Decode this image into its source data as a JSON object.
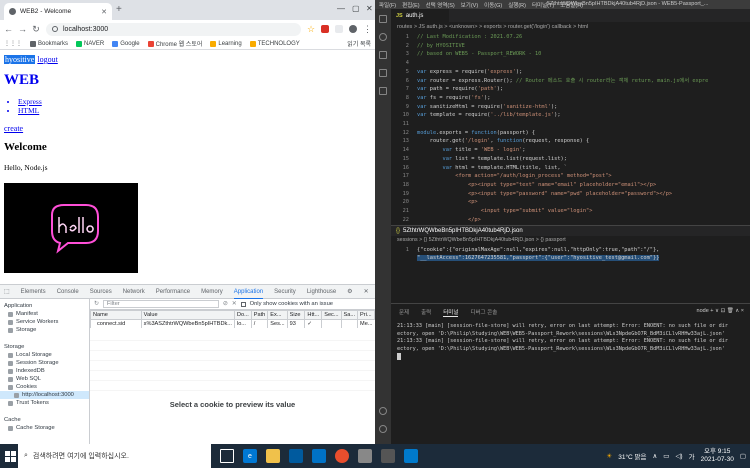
{
  "browser": {
    "tab_title": "WEB2 - Welcome",
    "url": "localhost:3000",
    "bookmarks": [
      "Bookmarks",
      "NAVER",
      "Google",
      "Chrome 웹 스토어",
      "Learning",
      "TECHNOLOGY",
      "읽기 목록"
    ]
  },
  "page": {
    "user_label": "hyositive",
    "logout_label": "logout",
    "site_title": "WEB",
    "list": [
      "Express",
      "HTML"
    ],
    "create_label": "create",
    "heading": "Welcome",
    "body": "Hello, Node.js"
  },
  "devtools": {
    "tabs": [
      "Elements",
      "Console",
      "Sources",
      "Network",
      "Performance",
      "Memory",
      "Application",
      "Security",
      "Lighthouse"
    ],
    "active_tab": "Application",
    "filter_placeholder": "Filter",
    "only_issue_label": "Only show cookies with an issue",
    "sidebar": {
      "application_label": "Application",
      "application_items": [
        "Manifest",
        "Service Workers",
        "Storage"
      ],
      "storage_label": "Storage",
      "storage_items": [
        "Local Storage",
        "Session Storage",
        "IndexedDB",
        "Web SQL",
        "Cookies",
        "http://localhost:3000",
        "Trust Tokens"
      ],
      "cache_label": "Cache",
      "cache_items": [
        "Cache Storage"
      ]
    },
    "columns": [
      "Name",
      "Value",
      "Do...",
      "Path",
      "Ex...",
      "Size",
      "Htt...",
      "Sec...",
      "Sa...",
      "Pri..."
    ],
    "row": [
      "connect.sid",
      "s%3ASZthtrWQWbeBn5pIHTBDk...",
      "lo...",
      "/",
      "Ses...",
      "93",
      "✓",
      "",
      "",
      "Me..."
    ],
    "preview_text": "Select a cookie to preview its value"
  },
  "vscode": {
    "menu": [
      "파일(F)",
      "편집(E)",
      "선택 영역(S)",
      "보기(V)",
      "이동(G)",
      "실행(R)",
      "터미널(T)",
      "도움말(H)"
    ],
    "window_title": "5ZthtrWQWbeBn5pIHTBDkjA40tub4RjD.json - WEB5-Passport_...",
    "editor_tab": "auth.js",
    "breadcrumb": "routes > JS auth.js > <unknown> > exports > router.get('/login') callback > html",
    "code_lines": [
      "// Last Modification : 2021.07.26",
      "// by HYOSITIVE",
      "// based on WEB5 - Passport_REWORK - 10",
      "",
      "var express = require('express');",
      "var router = express.Router(); // Router 메소드 호출 시 router라는 객체 return, main.js에서 expre",
      "var path = require('path');",
      "var fs = require('fs');",
      "var sanitizeHtml = require('sanitize-html');",
      "var template = require('../lib/template.js');",
      "",
      "module.exports = function(passport) {",
      "    router.get('/login', function(request, response) {",
      "        var title = 'WEB - login';",
      "        var list = template.list(request.list);",
      "        var html = template.HTML(title, list, `",
      "            <form action=\"/auth/login_process\" method=\"post\">",
      "                <p><input type=\"text\" name=\"email\" placeholder=\"email\"></p>",
      "                <p><input type=\"password\" name=\"pwd\" placeholder=\"password\"></p>",
      "                <p>",
      "                    <input type=\"submit\" value=\"login\">",
      "                </p>"
    ],
    "json_tab": "5ZthtrWQWbeBn5pIHTBDkjA40tub4RjD.json",
    "json_breadcrumb": "sessions > {} 5ZthtrWQWbeBn5pIHTBDkjA40tub4RjD.json > {} passport",
    "json_line1": "{\"cookie\":{\"originalMaxAge\":null,\"expires\":null,\"httpOnly\":true,\"path\":\"/\"},",
    "json_line2": "\"__lastAccess\":1627647235581,\"passport\":{\"user\":\"hyositive_test@gmail.com\"}}",
    "terminal_tabs": [
      "문제",
      "출력",
      "터미널",
      "디버그 콘솔"
    ],
    "terminal_active": "터미널",
    "terminal_right": "node  +  ∨  ⊡  🗑  ∧  ×",
    "terminal_lines": [
      "21:13:33 [main] [session-file-store] will retry, error on last attempt: Error: ENOENT: no such file or dir",
      "ectory, open 'D:\\Philip\\Studying\\WEB\\WEB5-Passport_Rework\\sessions\\WLs3NpdeGbO7R_BdM3iCLlvRHHw33ajL.json'",
      "21:13:33 [main] [session-file-store] will retry, error on last attempt: Error: ENOENT: no such file or dir",
      "ectory, open 'D:\\Philip\\Studying\\WEB\\WEB5-Passport_Rework\\sessions\\WLs3NpdeGbO7R_BdM3iCLlvRHHw33ajL.json'"
    ]
  },
  "taskbar": {
    "search_placeholder": "검색하려면 여기에 입력하십시오.",
    "weather": "31°C 맑음",
    "time": "오후 9:15",
    "date": "2021-07-30"
  },
  "colors": {
    "accent": "#1a73e8",
    "vscode_bg": "#1e1e1e",
    "taskbar": "#1c2b3a"
  }
}
